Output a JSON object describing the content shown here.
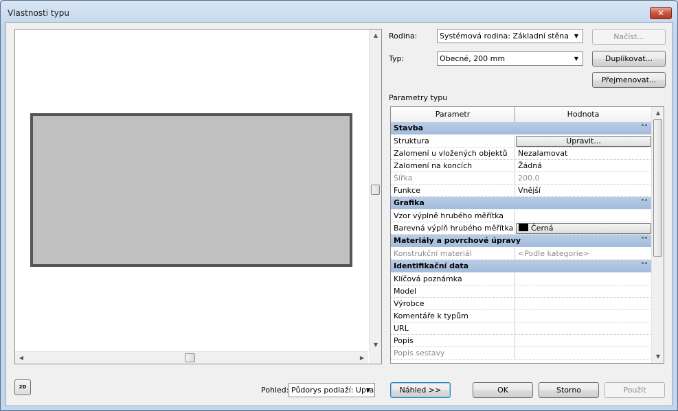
{
  "window": {
    "title": "Vlastnosti typu"
  },
  "family": {
    "label": "Rodina:",
    "value": "Systémová rodina: Základní stěna",
    "load_button": "Načíst..."
  },
  "type": {
    "label": "Typ:",
    "value": "Obecné, 200 mm",
    "duplicate_button": "Duplikovat...",
    "rename_button": "Přejmenovat..."
  },
  "params": {
    "section_label": "Parametry typu",
    "columns": [
      "Parametr",
      "Hodnota"
    ],
    "groups": [
      {
        "name": "Stavba",
        "rows": [
          {
            "param": "Struktura",
            "value": "Upravit...",
            "kind": "button"
          },
          {
            "param": "Zalomení u vložených objektů",
            "value": "Nezalamovat"
          },
          {
            "param": "Zalomení na koncích",
            "value": "Žádná"
          },
          {
            "param": "Šířka",
            "value": "200.0",
            "gray": true
          },
          {
            "param": "Funkce",
            "value": "Vnější"
          }
        ]
      },
      {
        "name": "Grafika",
        "rows": [
          {
            "param": "Vzor výplně hrubého měřítka",
            "value": ""
          },
          {
            "param": "Barevná výplň hrubého měřítka",
            "value": "Černá",
            "kind": "color"
          }
        ]
      },
      {
        "name": "Materiály a povrchové úpravy",
        "rows": [
          {
            "param": "Konstrukční materiál",
            "value": "<Podle kategorie>",
            "gray": true
          }
        ]
      },
      {
        "name": "Identifikační data",
        "rows": [
          {
            "param": "Klíčová poznámka",
            "value": ""
          },
          {
            "param": "Model",
            "value": ""
          },
          {
            "param": "Výrobce",
            "value": ""
          },
          {
            "param": "Komentáře k typům",
            "value": ""
          },
          {
            "param": "URL",
            "value": ""
          },
          {
            "param": "Popis",
            "value": ""
          },
          {
            "param": "Popis sestavy",
            "value": "",
            "gray": true
          }
        ]
      }
    ]
  },
  "footer": {
    "view_label": "Pohled:",
    "view_value": "Půdorys podlaží: Upra",
    "preview_button": "Náhled >>",
    "ok_button": "OK",
    "cancel_button": "Storno",
    "apply_button": "Použít",
    "view2d_icon_text": "2D"
  },
  "colors": {
    "group_header": "#a8c0de",
    "wall_fill": "#c0c0c0",
    "wall_border": "#555555"
  }
}
